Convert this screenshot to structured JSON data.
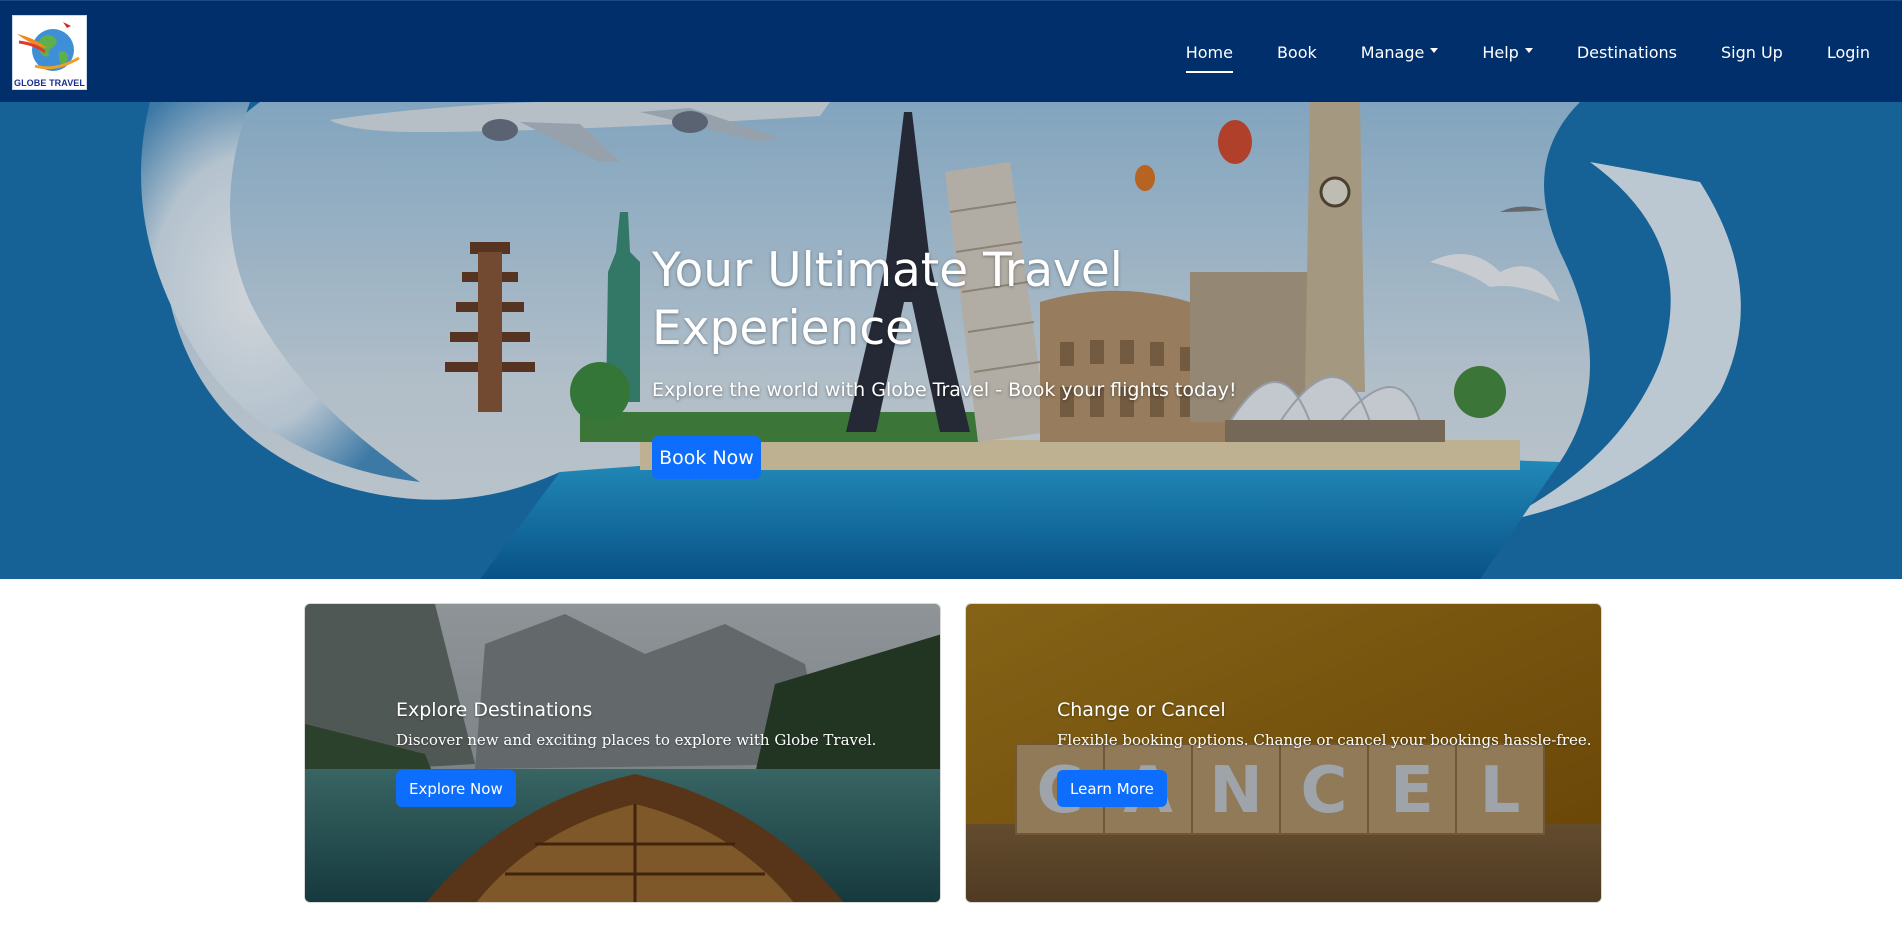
{
  "brand": {
    "logo_text": "GLOBE TRAVEL"
  },
  "nav": {
    "items": [
      {
        "label": "Home",
        "active": true,
        "dropdown": false
      },
      {
        "label": "Book",
        "active": false,
        "dropdown": false
      },
      {
        "label": "Manage",
        "active": false,
        "dropdown": true
      },
      {
        "label": "Help",
        "active": false,
        "dropdown": true
      },
      {
        "label": "Destinations",
        "active": false,
        "dropdown": false
      },
      {
        "label": "Sign Up",
        "active": false,
        "dropdown": false
      },
      {
        "label": "Login",
        "active": false,
        "dropdown": false
      }
    ]
  },
  "hero": {
    "title": "Your Ultimate Travel Experience",
    "subtitle": "Explore the world with Globe Travel - Book your flights today!",
    "button": "Book Now"
  },
  "cards": [
    {
      "title": "Explore Destinations",
      "text": "Discover new and exciting places to explore with Globe Travel.",
      "button": "Explore Now"
    },
    {
      "title": "Change or Cancel",
      "text": "Flexible booking options. Change or cancel your bookings hassle-free.",
      "button": "Learn More",
      "image_letters": [
        "C",
        "A",
        "N",
        "C",
        "E",
        "L"
      ]
    }
  ],
  "colors": {
    "navbar": "#002f6c",
    "primary": "#0d6efd",
    "card_cancel_bg": "#9a6a10"
  }
}
